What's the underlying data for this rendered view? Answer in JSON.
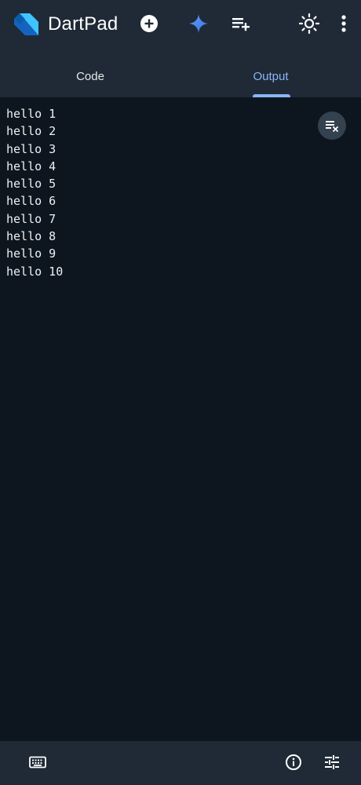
{
  "app": {
    "title": "DartPad"
  },
  "header": {
    "icons": [
      "dart-logo",
      "add-circle-icon",
      "gemini-sparkle-icon",
      "playlist-add-icon",
      "theme-sun-icon",
      "more-vert-icon"
    ],
    "accent_color": "#8ab4f8",
    "sparkle_color": "#4c8df6"
  },
  "tabs": [
    {
      "label": "Code",
      "active": false
    },
    {
      "label": "Output",
      "active": true
    }
  ],
  "console": {
    "lines": [
      "hello 1",
      "hello 2",
      "hello 3",
      "hello 4",
      "hello 5",
      "hello 6",
      "hello 7",
      "hello 8",
      "hello 9",
      "hello 10"
    ],
    "clear_icon": "clear-all-icon"
  },
  "footer": {
    "icons": [
      "keyboard-icon",
      "info-icon",
      "tune-icon"
    ]
  }
}
